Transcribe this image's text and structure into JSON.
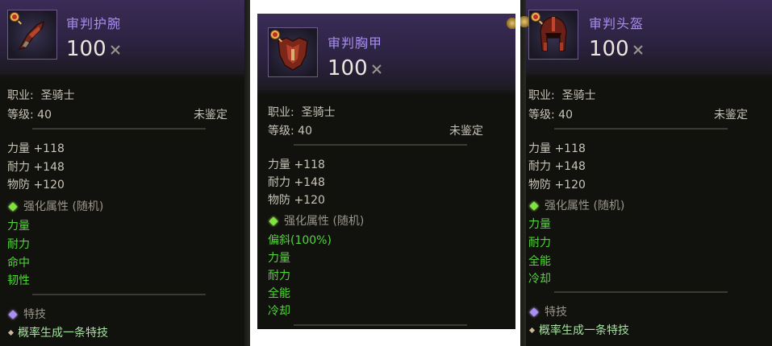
{
  "cards": [
    {
      "icon": "bracer-icon",
      "name": "审判护腕",
      "power": "100",
      "class_label": "职业:",
      "class_value": "圣骑士",
      "level_label": "等级:",
      "level_value": "40",
      "status": "未鉴定",
      "stats": [
        "力量 +118",
        "耐力 +148",
        "物防 +120"
      ],
      "enhance_title": "强化属性 (随机)",
      "enhance_items": [
        "力量",
        "耐力",
        "命中",
        "韧性"
      ],
      "skill_title": "特技",
      "skill_text": "概率生成一条特技"
    },
    {
      "icon": "chestplate-icon",
      "name": "审判胸甲",
      "power": "100",
      "class_label": "职业:",
      "class_value": "圣骑士",
      "level_label": "等级:",
      "level_value": "40",
      "status": "未鉴定",
      "stats": [
        "力量 +118",
        "耐力 +148",
        "物防 +120"
      ],
      "enhance_title": "强化属性 (随机)",
      "enhance_items": [
        "偏斜(100%)",
        "力量",
        "耐力",
        "全能",
        "冷却"
      ]
    },
    {
      "icon": "helmet-icon",
      "name": "审判头盔",
      "power": "100",
      "class_label": "职业:",
      "class_value": "圣骑士",
      "level_label": "等级:",
      "level_value": "40",
      "status": "未鉴定",
      "stats": [
        "力量 +118",
        "耐力 +148",
        "物防 +120"
      ],
      "enhance_title": "强化属性 (随机)",
      "enhance_items": [
        "力量",
        "耐力",
        "全能",
        "冷却"
      ],
      "skill_title": "特技",
      "skill_text": "概率生成一条特技"
    }
  ],
  "colors": {
    "name": "#a78ef0",
    "green": "#52d63a",
    "panel": "#11110d",
    "header": "#2b2240"
  }
}
